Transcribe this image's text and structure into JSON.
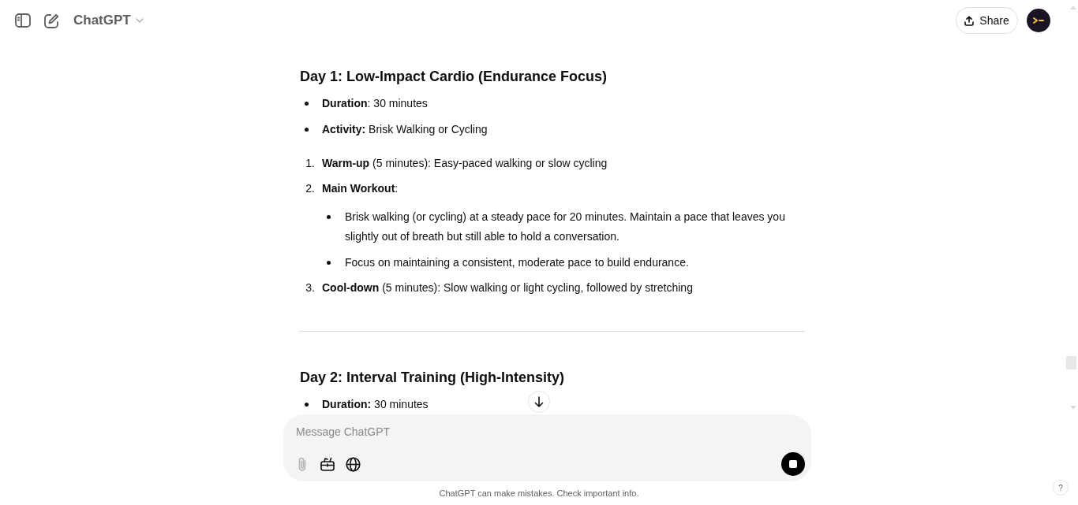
{
  "header": {
    "title": "ChatGPT",
    "share_label": "Share"
  },
  "message": [
    {
      "kind": "heading",
      "text": "Day 1: Low-Impact Cardio (Endurance Focus)"
    },
    {
      "kind": "bullets",
      "items": [
        {
          "text": "**Duration**: 30 minutes"
        },
        {
          "text": "**Activity:** Brisk Walking or Cycling"
        }
      ]
    },
    {
      "kind": "steps",
      "items": [
        {
          "number": "1.",
          "text": "**Warm-up** (5 minutes): Easy-paced walking or slow cycling"
        },
        {
          "number": "2.",
          "text": "**Main Workout**:",
          "children": [
            {
              "text": "Brisk walking (or cycling) at a steady pace for 20 minutes. Maintain a pace that leaves you slightly out of breath but still able to hold a conversation."
            },
            {
              "text": "Focus on maintaining a consistent, moderate pace to build endurance."
            }
          ]
        },
        {
          "number": "3.",
          "text": "**Cool-down** (5 minutes): Slow walking or light cycling, followed by stretching"
        }
      ]
    },
    {
      "kind": "divider"
    },
    {
      "kind": "heading",
      "text": "Day 2: Interval Training (High-Intensity)"
    },
    {
      "kind": "bullets",
      "items": [
        {
          "text": "**Duration:** 30 minutes"
        }
      ]
    }
  ],
  "composer": {
    "placeholder": "Message ChatGPT",
    "attach": {
      "disabled": true
    }
  },
  "disclaimer": "ChatGPT can make mistakes. Check important info.",
  "help_label": "?"
}
